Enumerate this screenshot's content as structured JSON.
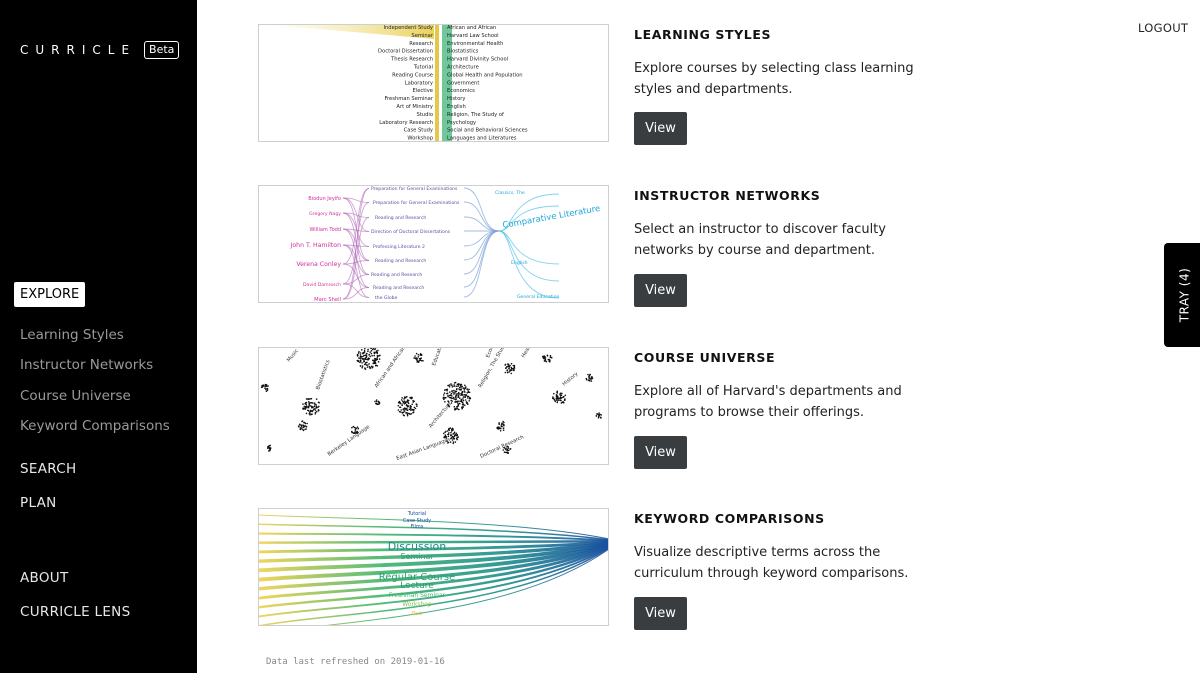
{
  "brand": {
    "name": "CURRICLE",
    "badge": "Beta"
  },
  "sidebar": {
    "explore": "EXPLORE",
    "sub_items": [
      "Learning Styles",
      "Instructor Networks",
      "Course Universe",
      "Keyword Comparisons"
    ],
    "search": "SEARCH",
    "plan": "PLAN",
    "about": "ABOUT",
    "lens": "CURRICLE LENS"
  },
  "header": {
    "logout": "LOGOUT"
  },
  "tray": {
    "label": "TRAY (4)"
  },
  "cards": [
    {
      "title": "LEARNING STYLES",
      "description": "Explore courses by selecting class learning styles and departments.",
      "button": "View",
      "thumb_left": [
        "Independent Study",
        "Seminar",
        "Research",
        "Doctoral Dissertation",
        "Thesis Research",
        "Tutorial",
        "Reading Course",
        "Laboratory",
        "Elective",
        "Freshman Seminar",
        "Art of Ministry",
        "Studio",
        "Laboratory Research",
        "Case Study",
        "Workshop"
      ],
      "thumb_right": [
        "African and African",
        "Harvard Law School",
        "Environmental Health",
        "Biostatistics",
        "Harvard Divinity School",
        "Architecture",
        "Global Health and Population",
        "Government",
        "Economics",
        "History",
        "English",
        "Religion, The Study of",
        "Psychology",
        "Social and Behavioral Sciences",
        "Languages and Literatures"
      ]
    },
    {
      "title": "INSTRUCTOR NETWORKS",
      "description": "Select an instructor to discover faculty networks by course and department.",
      "button": "View",
      "instructors": [
        "Biodun Jeyifo",
        "Gregory Nagy",
        "William Todd",
        "John T. Hamilton",
        "Verena Conley",
        "David Damrosch",
        "Marc Shell"
      ],
      "courses": [
        "Preparation for General Examinations",
        "Preparation for General Examinations",
        "Reading and Research",
        "Direction of Doctoral Dissertations",
        "Professing Literature 2",
        "Reading and Research",
        "Reading and Research",
        "Reading and Research",
        "the Globe"
      ],
      "department": "Comparative Literature",
      "others": [
        "Classics, The",
        "English",
        "General Education"
      ]
    },
    {
      "title": "COURSE UNIVERSE",
      "description": "Explore all of Harvard's departments and programs to browse their offerings.",
      "button": "View",
      "labels": [
        "Biostatistics",
        "African and African A",
        "Education",
        "Architecture",
        "Religion, The Study of",
        "Berkeley Language",
        "East Asian Languages",
        "Doctoral Research",
        "Economics",
        "Health",
        "Music",
        "History"
      ]
    },
    {
      "title": "KEYWORD COMPARISONS",
      "description": "Visualize descriptive terms across the curriculum through keyword comparisons.",
      "button": "View",
      "keywords": [
        "Tutorial",
        "Case Study",
        "Films",
        "Discussion",
        "Seminar",
        "Regular Course",
        "Lecture",
        "Freshman Seminar",
        "Workshop",
        "Quiz"
      ]
    }
  ],
  "footer": {
    "refresh": "Data last refreshed on 2019-01-16"
  }
}
